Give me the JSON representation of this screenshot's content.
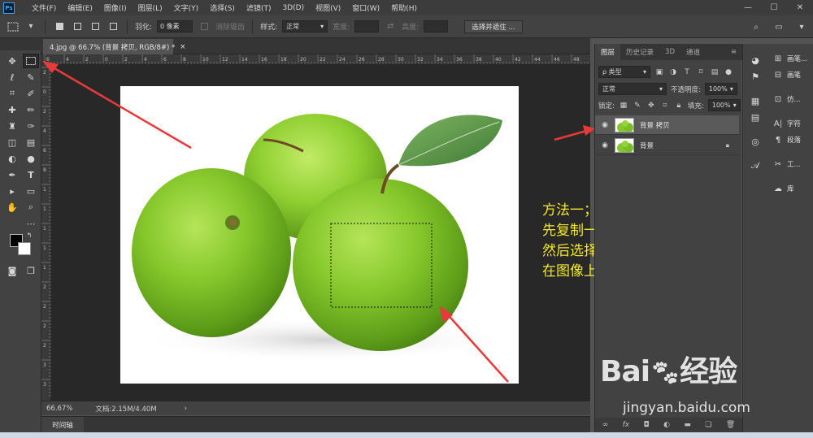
{
  "app": {
    "logo": "Ps"
  },
  "menu": [
    "文件(F)",
    "编辑(E)",
    "图像(I)",
    "图层(L)",
    "文字(Y)",
    "选择(S)",
    "滤镜(T)",
    "3D(D)",
    "视图(V)",
    "窗口(W)",
    "帮助(H)"
  ],
  "window_controls": {
    "minimize": "—",
    "maximize": "☐",
    "close": "✕"
  },
  "options": {
    "feather_label": "羽化:",
    "feather_value": "0 像素",
    "antialias_label": "消除锯齿",
    "style_label": "样式:",
    "style_value": "正常",
    "width_label": "宽度:",
    "height_label": "高度:",
    "select_mask_button": "选择并遮住 ..."
  },
  "document": {
    "tab_title": "4.jpg @ 66.7% (背景 拷贝, RGB/8#) *",
    "tab_close": "×",
    "zoom": "66.67%",
    "doc_info": "文档:2.15M/4.40M",
    "status_arrow": "›",
    "ruler_marks": [
      "6",
      "4",
      "2",
      "0",
      "2",
      "4",
      "6",
      "8",
      "10",
      "12",
      "14",
      "16",
      "18",
      "20",
      "22",
      "24",
      "26",
      "28",
      "30",
      "32",
      "34",
      "36",
      "38",
      "40",
      "42",
      "44",
      "46",
      "48"
    ],
    "ruler_left_marks": [
      "2",
      "0",
      "2",
      "4",
      "6",
      "8",
      "1",
      "1",
      "1",
      "1",
      "1",
      "2",
      "2",
      "2",
      "2",
      "3",
      "3"
    ]
  },
  "timeline": {
    "label": "时间轴"
  },
  "annotation": {
    "lines": [
      "方法一；打开一张图，",
      "先复制一个图层，",
      "然后选择矩形工具，",
      "在图像上选择一个选区"
    ],
    "color": "#f4e829"
  },
  "layers_panel": {
    "tabs": [
      "图层",
      "历史记录",
      "3D",
      "通道"
    ],
    "filter_label": "ρ 类型",
    "blend_mode": "正常",
    "opacity_label": "不透明度:",
    "opacity_value": "100%",
    "lock_label": "锁定:",
    "fill_label": "填充:",
    "fill_value": "100%",
    "layers": [
      {
        "name": "背景 拷贝"
      },
      {
        "name": "背景"
      }
    ],
    "footer_icons": [
      "link-icon",
      "fx-icon",
      "mask-icon",
      "adjustment-icon",
      "folder-icon",
      "new-layer-icon",
      "trash-icon"
    ],
    "footer_fx": "fx"
  },
  "right_column": {
    "items": [
      "画笔...",
      "画笔",
      "仿...",
      "字符",
      "段落",
      "工...",
      "库"
    ]
  },
  "watermark": {
    "logo": "Bai",
    "logo_tail": "经验",
    "url": "jingyan.baidu.com"
  },
  "colors": {
    "accent_blue": "#31a8ff",
    "apple_green": "#7fc62a",
    "arrow_red": "#e83a3a"
  }
}
